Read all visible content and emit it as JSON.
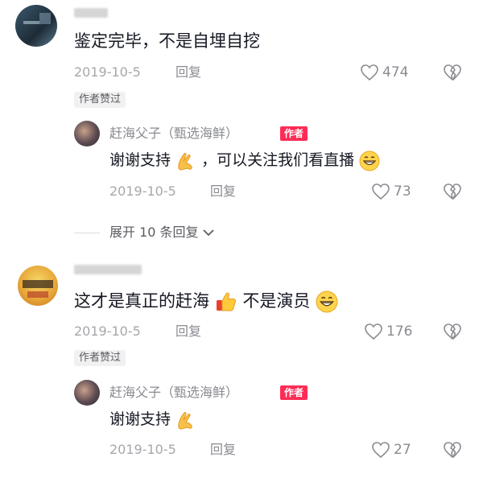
{
  "comments": [
    {
      "text": "鉴定完毕，不是自埋自挖",
      "date": "2019-10-5",
      "reply_label": "回复",
      "likes": "474",
      "liked_badge": "作者赞过",
      "reply": {
        "author": "赶海父子（甄选海鲜）",
        "author_tag": "作者",
        "text_before": "谢谢支持",
        "text_after": "，可以关注我们看直播",
        "date": "2019-10-5",
        "reply_label": "回复",
        "likes": "73"
      },
      "expand_label": "展开 10 条回复"
    },
    {
      "text_before": "这才是真正的赶海",
      "text_after": "不是演员",
      "date": "2019-10-5",
      "reply_label": "回复",
      "likes": "176",
      "liked_badge": "作者赞过",
      "reply": {
        "author": "赶海父子（甄选海鲜）",
        "author_tag": "作者",
        "text_before": "谢谢支持",
        "date": "2019-10-5",
        "reply_label": "回复",
        "likes": "27"
      }
    }
  ],
  "colors": {
    "accent": "#fe2c55",
    "muted": "#a6a7ab"
  },
  "icons": [
    "heart-icon",
    "broken-heart-icon",
    "chevron-down-icon",
    "clap-hands-emoji",
    "grin-emoji",
    "thumbs-up-emoji"
  ]
}
